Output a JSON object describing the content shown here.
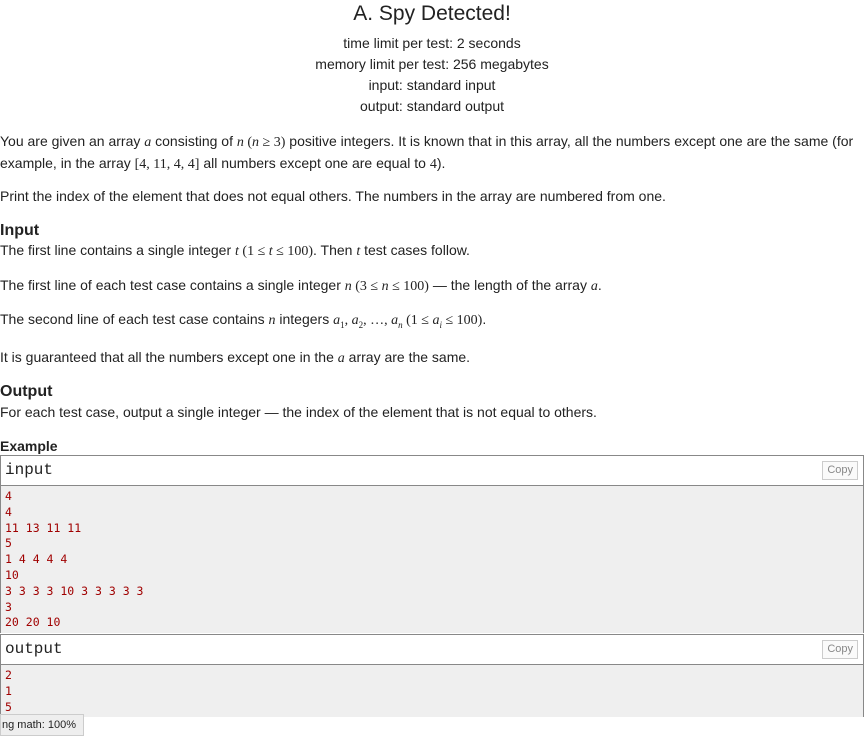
{
  "problem": {
    "title": "A. Spy Detected!",
    "time_limit": "time limit per test: 2 seconds",
    "memory_limit": "memory limit per test: 256 megabytes",
    "input_file": "input: standard input",
    "output_file": "output: standard output"
  },
  "statement": {
    "p1_a": "You are given an array ",
    "p1_b": " consisting of ",
    "p1_c": " positive integers. It is known that in this array, all the numbers except one are the same (for example, in the array ",
    "p1_d": " all numbers except one are equal to ",
    "p1_e": ").",
    "p2": "Print the index of the element that does not equal others. The numbers in the array are numbered from one."
  },
  "input_section": {
    "title": "Input",
    "l1_a": "The first line contains a single integer ",
    "l1_b": ". Then ",
    "l1_c": " test cases follow.",
    "l2_a": "The first line of each test case contains a single integer ",
    "l2_b": " — the length of the array ",
    "l2_c": ".",
    "l3_a": "The second line of each test case contains ",
    "l3_b": " integers ",
    "l3_c": ".",
    "l4_a": "It is guaranteed that all the numbers except one in the ",
    "l4_b": " array are the same."
  },
  "output_section": {
    "title": "Output",
    "text": "For each test case, output a single integer — the index of the element that is not equal to others."
  },
  "example": {
    "title": "Example",
    "input_label": "input",
    "output_label": "output",
    "copy_label": "Copy",
    "input_lines": [
      "4",
      "4",
      "11 13 11 11",
      "5",
      "1 4 4 4 4",
      "10",
      "3 3 3 3 10 3 3 3 3 3",
      "3",
      "20 20 10"
    ],
    "output_lines": [
      "2",
      "1",
      "5"
    ]
  },
  "zoom_badge": "ng math: 100%"
}
